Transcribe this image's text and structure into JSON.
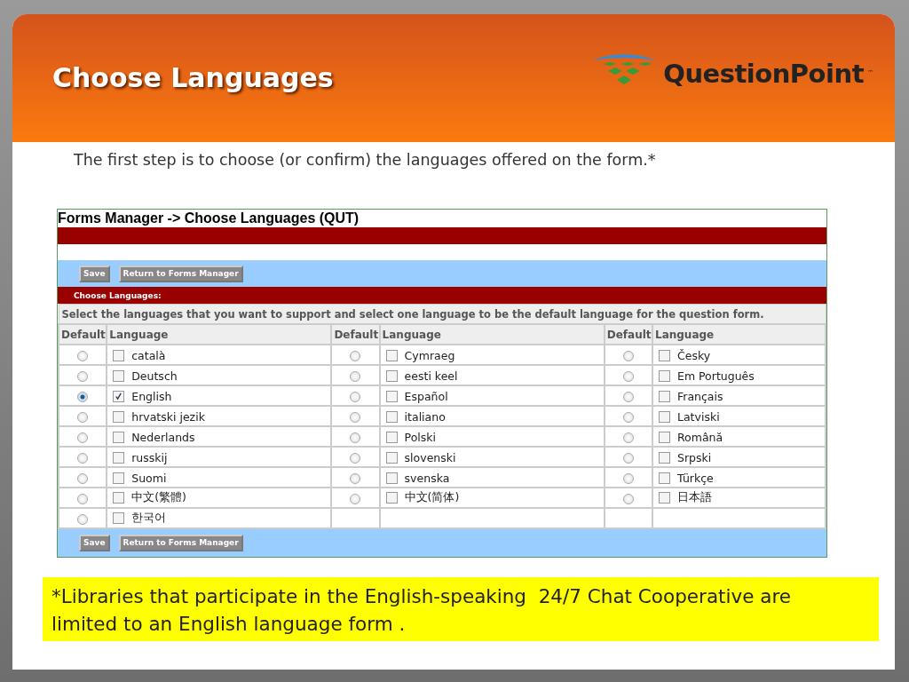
{
  "slide": {
    "title": "Choose Languages",
    "logo": {
      "name": "QuestionPoint",
      "mark": "™"
    },
    "intro": "The first step is to choose (or confirm) the languages offered on the form.*",
    "footnote": "*Libraries that participate in the English-speaking  24/7 Chat Cooperative are limited to an English language form ."
  },
  "app": {
    "title": "Forms Manager -> Choose Languages (QUT)",
    "buttons_top": [
      "Save",
      "Return to Forms Manager"
    ],
    "section": "Choose Languages:",
    "instruction": "Select the languages that you want to support and select one language to be the default language for the question form.",
    "columns": [
      "Default",
      "Language",
      "Default",
      "Language",
      "Default",
      "Language"
    ],
    "rows": [
      {
        "cells": [
          {
            "default": false
          },
          {
            "name": "català",
            "checked": false
          },
          {
            "default": false
          },
          {
            "name": "Cymraeg",
            "checked": false
          },
          {
            "default": false
          },
          {
            "name": "Česky",
            "checked": false
          }
        ]
      },
      {
        "cells": [
          {
            "default": false
          },
          {
            "name": "Deutsch",
            "checked": false
          },
          {
            "default": false
          },
          {
            "name": "eesti keel",
            "checked": false
          },
          {
            "default": false
          },
          {
            "name": "Em Português",
            "checked": false
          }
        ]
      },
      {
        "cells": [
          {
            "default": true
          },
          {
            "name": "English",
            "checked": true
          },
          {
            "default": false
          },
          {
            "name": "Español",
            "checked": false
          },
          {
            "default": false
          },
          {
            "name": "Français",
            "checked": false
          }
        ]
      },
      {
        "cells": [
          {
            "default": false
          },
          {
            "name": "hrvatski jezik",
            "checked": false
          },
          {
            "default": false
          },
          {
            "name": "italiano",
            "checked": false
          },
          {
            "default": false
          },
          {
            "name": "Latviski",
            "checked": false
          }
        ]
      },
      {
        "cells": [
          {
            "default": false
          },
          {
            "name": "Nederlands",
            "checked": false
          },
          {
            "default": false
          },
          {
            "name": "Polski",
            "checked": false
          },
          {
            "default": false
          },
          {
            "name": "Română",
            "checked": false
          }
        ]
      },
      {
        "cells": [
          {
            "default": false
          },
          {
            "name": "russkij",
            "checked": false
          },
          {
            "default": false
          },
          {
            "name": "slovenski",
            "checked": false
          },
          {
            "default": false
          },
          {
            "name": "Srpski",
            "checked": false
          }
        ]
      },
      {
        "cells": [
          {
            "default": false
          },
          {
            "name": "Suomi",
            "checked": false
          },
          {
            "default": false
          },
          {
            "name": "svenska",
            "checked": false
          },
          {
            "default": false
          },
          {
            "name": "Türkçe",
            "checked": false
          }
        ]
      },
      {
        "cells": [
          {
            "default": false
          },
          {
            "name": "中文(繁體)",
            "checked": false
          },
          {
            "default": false
          },
          {
            "name": "中文(简体)",
            "checked": false
          },
          {
            "default": false
          },
          {
            "name": "日本語",
            "checked": false
          }
        ]
      },
      {
        "cells": [
          {
            "default": false
          },
          {
            "name": "한국어",
            "checked": false
          }
        ]
      }
    ],
    "buttons_bottom": [
      "Save",
      "Return to Forms Manager"
    ]
  }
}
